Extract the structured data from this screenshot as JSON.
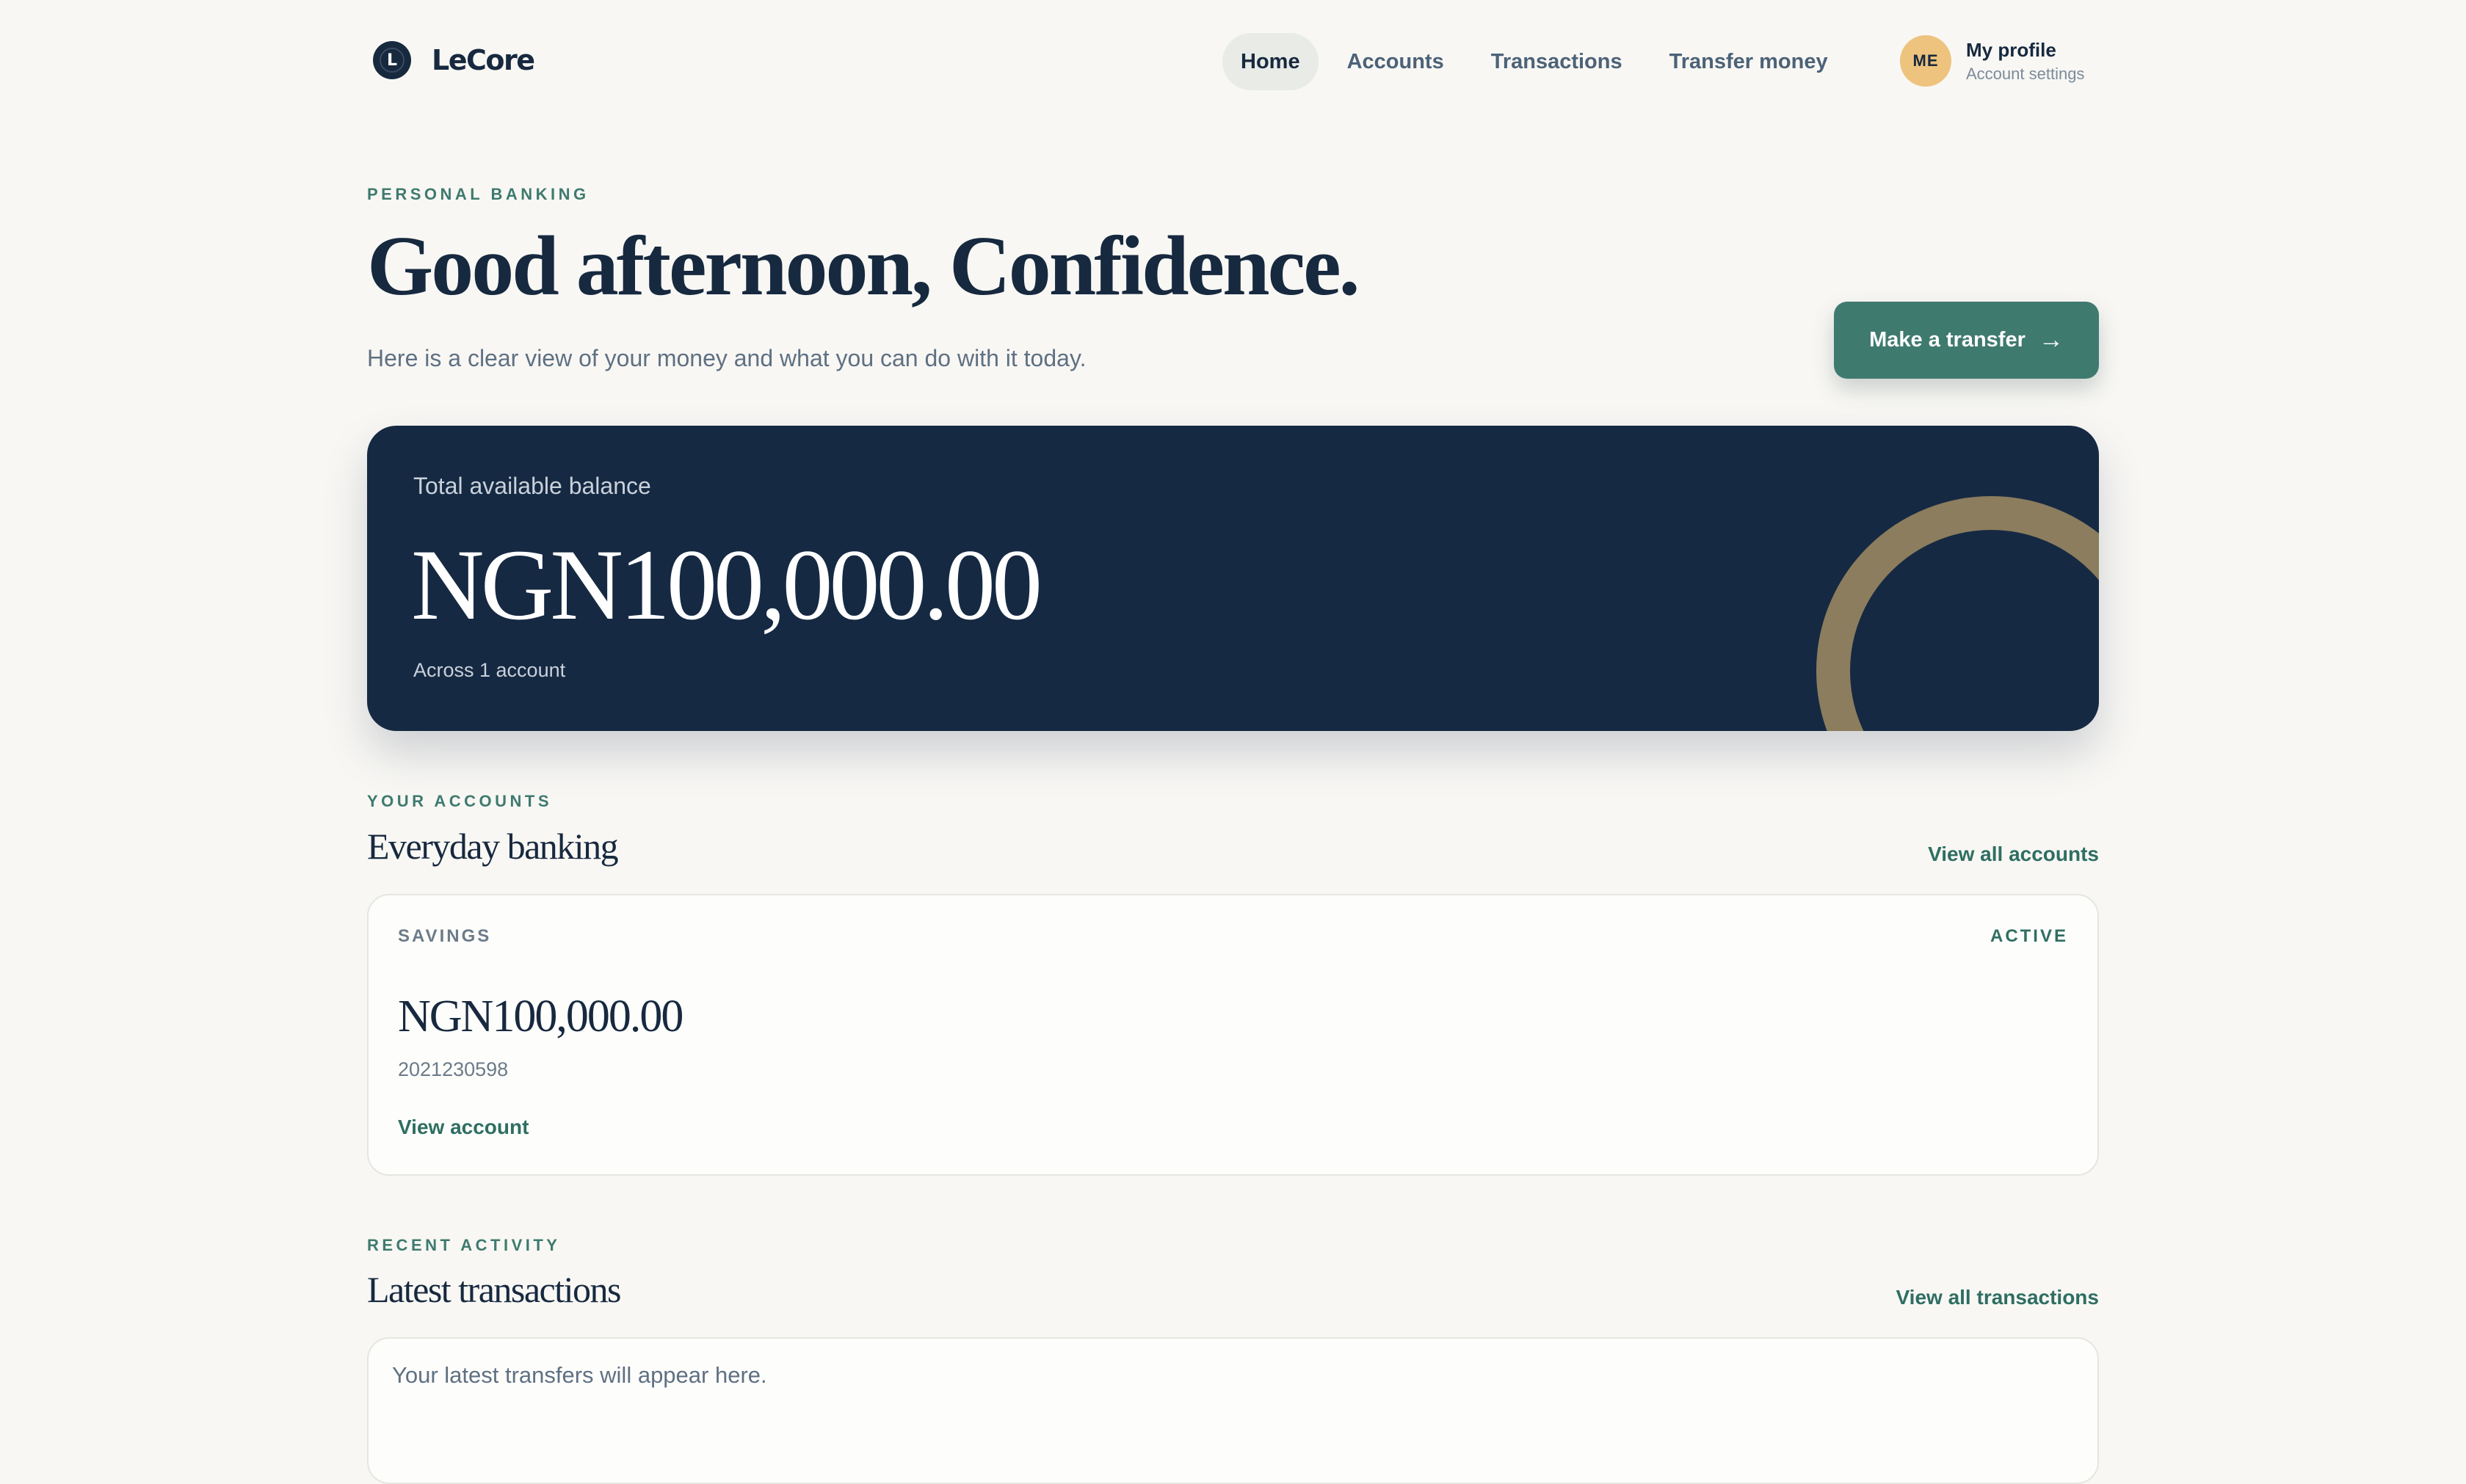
{
  "brand": {
    "name": "LeCore",
    "logo_letter": "L"
  },
  "nav": {
    "items": [
      {
        "label": "Home",
        "active": true
      },
      {
        "label": "Accounts",
        "active": false
      },
      {
        "label": "Transactions",
        "active": false
      },
      {
        "label": "Transfer money",
        "active": false
      }
    ]
  },
  "profile": {
    "initials": "ME",
    "name": "My profile",
    "subtitle": "Account settings"
  },
  "hero": {
    "eyebrow": "PERSONAL BANKING",
    "greeting": "Good afternoon, Confidence.",
    "subtitle": "Here is a clear view of your money and what you can do with it today.",
    "cta_label": "Make a transfer",
    "cta_icon": "arrow-right-icon"
  },
  "balance": {
    "label": "Total available balance",
    "value": "NGN100,000.00",
    "footnote": "Across 1 account"
  },
  "accounts_section": {
    "eyebrow": "YOUR ACCOUNTS",
    "title": "Everyday banking",
    "link": "View all accounts",
    "accounts": [
      {
        "type": "SAVINGS",
        "status": "ACTIVE",
        "balance": "NGN100,000.00",
        "number": "2021230598",
        "link": "View account"
      }
    ]
  },
  "activity_section": {
    "eyebrow": "RECENT ACTIVITY",
    "title": "Latest transactions",
    "link": "View all transactions",
    "empty_message": "Your latest transfers will appear here."
  },
  "colors": {
    "background": "#f8f7f4",
    "navy": "#162943",
    "accent_green": "#3f7a6f",
    "gold_ring": "#8b7d5d",
    "avatar": "#edc37e"
  }
}
